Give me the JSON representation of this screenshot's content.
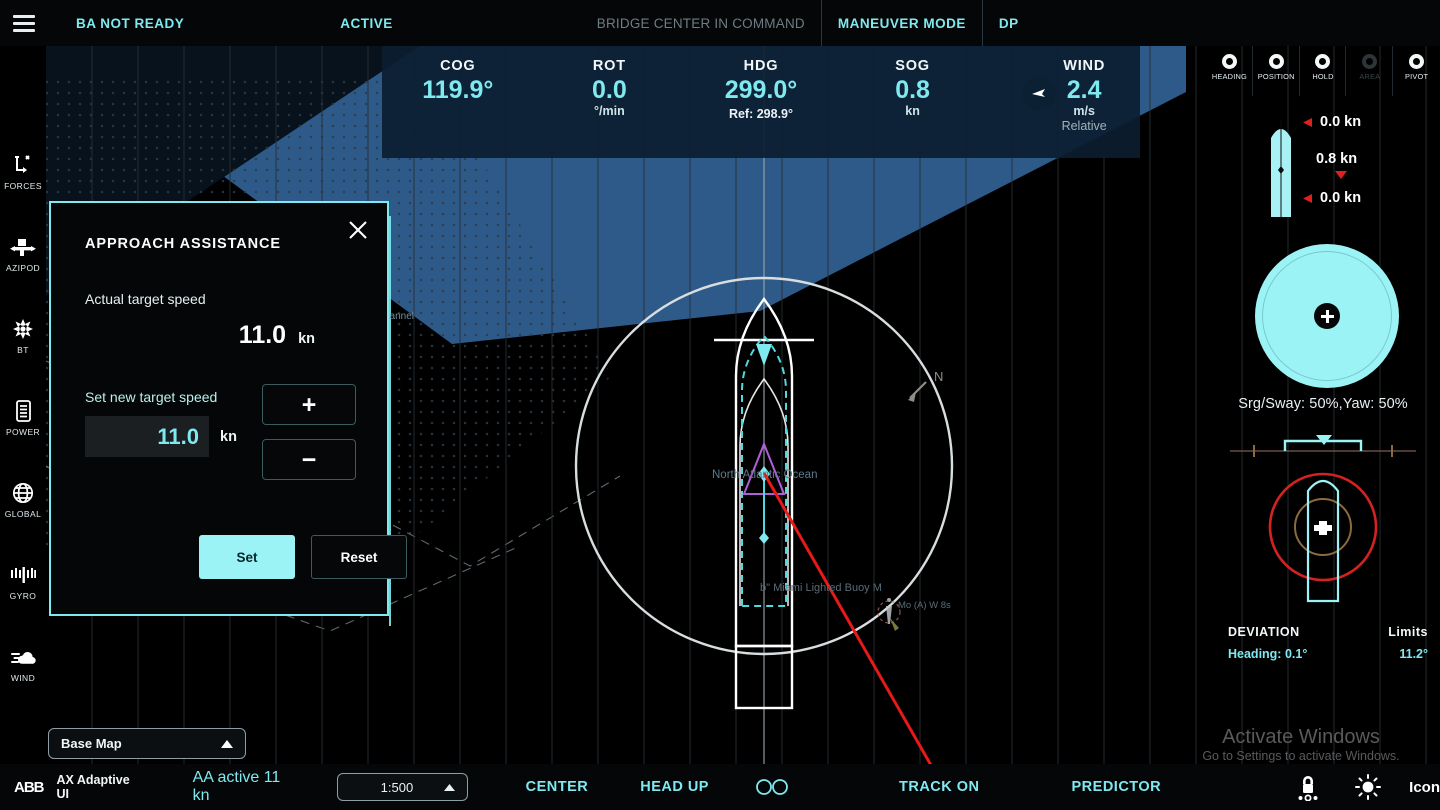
{
  "topbar": {
    "menu_icon": "hamburger-menu-icon",
    "items": [
      {
        "label": "BA NOT READY",
        "style": "accent"
      },
      {
        "label": "ACTIVE",
        "style": "accent"
      },
      {
        "label": "BRIDGE CENTER IN COMMAND",
        "style": "dim"
      },
      {
        "label": "MANEUVER MODE",
        "style": "accent"
      },
      {
        "label": "DP",
        "style": "accent"
      }
    ]
  },
  "navdata": [
    {
      "label": "COG",
      "value": "119.9°",
      "unit": "",
      "sub": ""
    },
    {
      "label": "ROT",
      "value": "0.0",
      "unit": "°/min",
      "sub": ""
    },
    {
      "label": "HDG",
      "value": "299.0°",
      "unit": "",
      "sub": "Ref: 298.9°"
    },
    {
      "label": "SOG",
      "value": "0.8",
      "unit": "kn",
      "sub": ""
    },
    {
      "label": "WIND",
      "value": "2.4",
      "unit": "m/s",
      "sub": "Relative"
    }
  ],
  "rail": [
    {
      "label": "FORCES",
      "icon": "forces-icon"
    },
    {
      "label": "AZIPOD",
      "icon": "azipod-icon"
    },
    {
      "label": "BT",
      "icon": "bow-thruster-icon"
    },
    {
      "label": "POWER",
      "icon": "power-icon"
    },
    {
      "label": "GLOBAL",
      "icon": "globe-icon"
    },
    {
      "label": "GYRO",
      "icon": "gyro-icon"
    },
    {
      "label": "WIND",
      "icon": "wind-icon"
    }
  ],
  "dialog": {
    "title": "APPROACH ASSISTANCE",
    "close_icon": "close-icon",
    "actual_label": "Actual target speed",
    "actual_value": "11.0",
    "actual_unit": "kn",
    "set_label": "Set new target speed",
    "input_value": "11.0",
    "input_unit": "kn",
    "plus_label": "+",
    "minus_label": "−",
    "set_button": "Set",
    "reset_button": "Reset",
    "accent_color": "#7fe9f0"
  },
  "right_panel": {
    "modes": [
      {
        "label": "HEADING",
        "active": true
      },
      {
        "label": "POSITION",
        "active": true
      },
      {
        "label": "HOLD",
        "active": true
      },
      {
        "label": "AREA",
        "active": false
      },
      {
        "label": "PIVOT",
        "active": true
      }
    ],
    "speeds": [
      {
        "value": "0.0 kn",
        "marker": "left-arrow",
        "color": "#e02020"
      },
      {
        "value": "0.8 kn",
        "marker": "down-arrow",
        "color": "#e02020"
      },
      {
        "value": "0.0 kn",
        "marker": "left-arrow",
        "color": "#e02020"
      }
    ],
    "joystick_caption": "Srg/Sway: 50%,Yaw: 50%",
    "deviation": {
      "title": "DEVIATION",
      "limits_title": "Limits",
      "heading_label": "Heading: 0.1°",
      "limit_value": "11.2°"
    }
  },
  "watermark": {
    "line1": "Activate Windows",
    "line2": "Go to Settings to activate Windows."
  },
  "basemap": {
    "label": "Base Map",
    "chevron": "chevron-up-icon"
  },
  "bottombar": {
    "brand": "ABB",
    "product": "AX Adaptive UI",
    "status": "AA active 11 kn",
    "scale": "1:500",
    "scale_chevron": "chevron-up-icon",
    "center": "CENTER",
    "headup": "HEAD UP",
    "eyes_icon": "binoculars-icon",
    "track": "TRACK ON",
    "predictor": "PREDICTOR",
    "lock_icon": "lock-icon",
    "brightness_icon": "brightness-icon",
    "icon_label": "Icon"
  },
  "map": {
    "ocean_label": "North Atlantic Ocean",
    "buoy_label": "b\" Miami Lighted Buoy M",
    "buoy_light": "Mo (A) W 8s",
    "channel_label": "hannel",
    "north_label": "N",
    "water_color": "#2f5f8f",
    "track_color": "#e81919",
    "vessel_color": "#ffffff",
    "predictor_color": "#d8dde0"
  }
}
